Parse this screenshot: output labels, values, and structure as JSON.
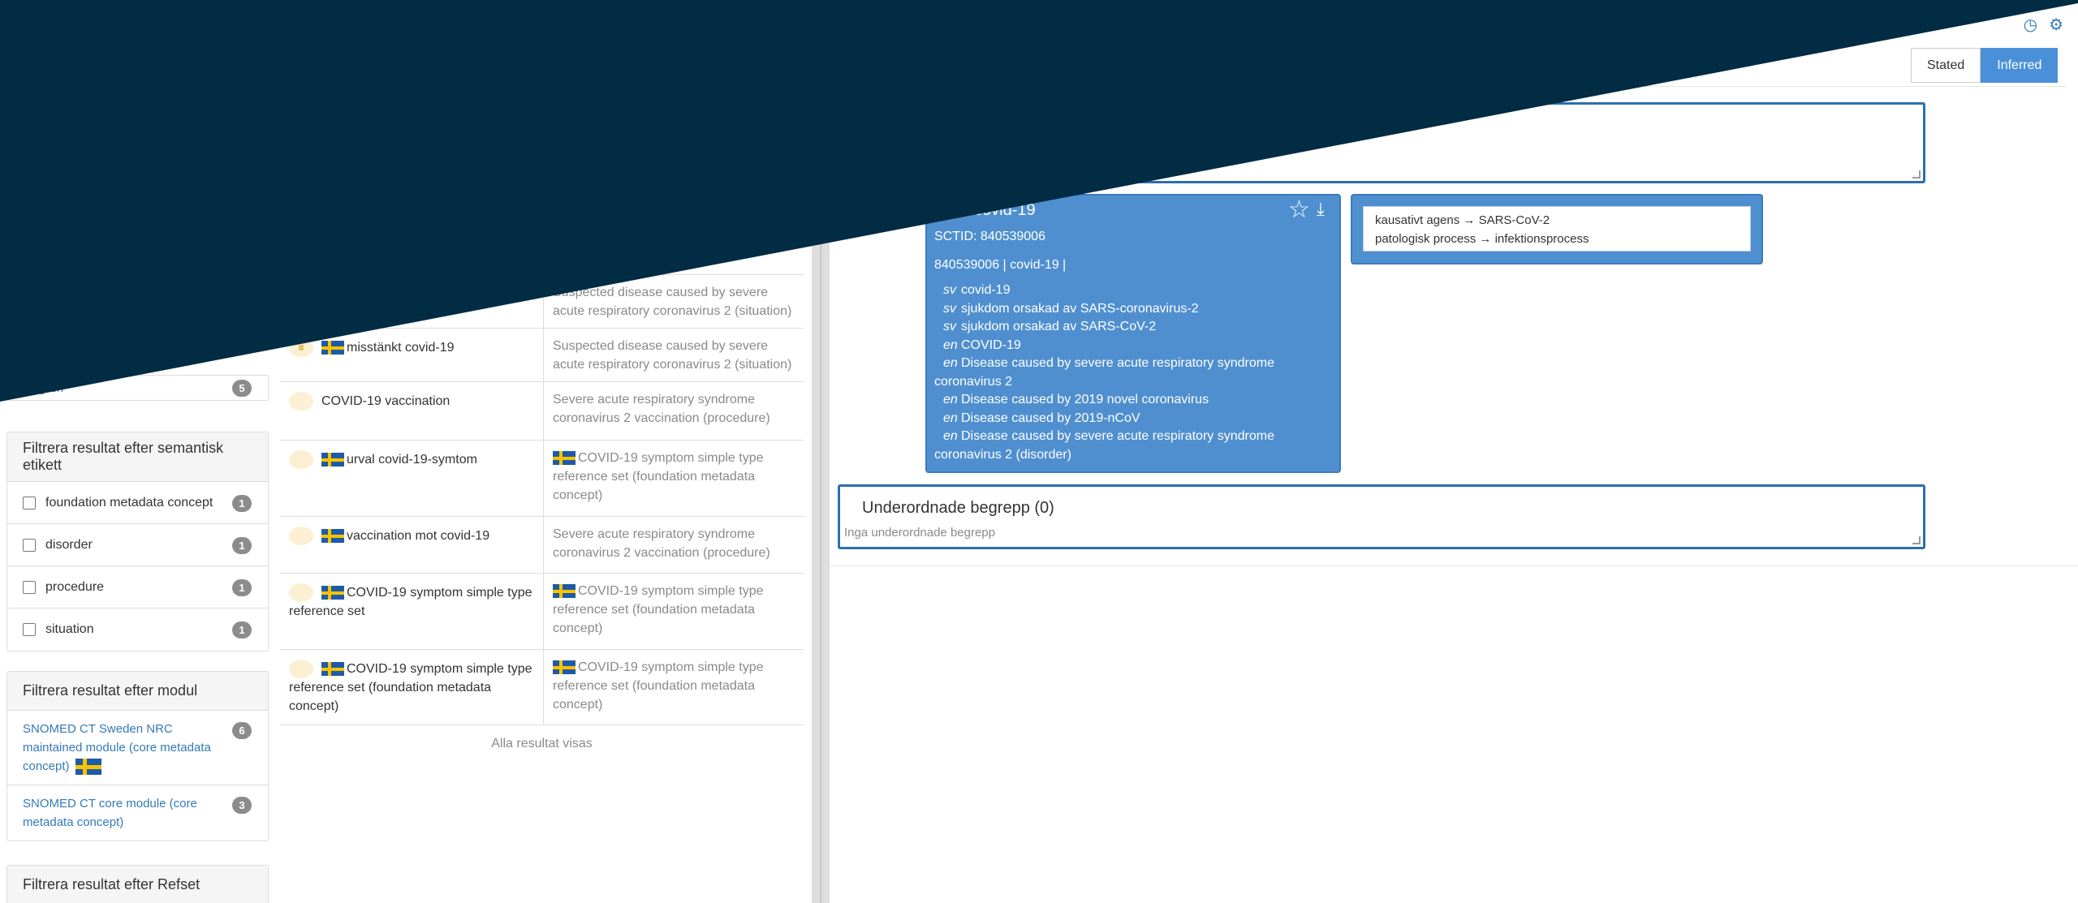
{
  "language_filter": {
    "label": "English",
    "count": "5"
  },
  "semantic_filter": {
    "title": "Filtrera resultat efter semantisk etikett",
    "items": [
      {
        "label": "foundation metadata concept",
        "count": "1"
      },
      {
        "label": "disorder",
        "count": "1"
      },
      {
        "label": "procedure",
        "count": "1"
      },
      {
        "label": "situation",
        "count": "1"
      }
    ]
  },
  "module_filter": {
    "title": "Filtrera resultat efter modul",
    "items": [
      {
        "label": "SNOMED CT Sweden NRC maintained module (core metadata concept)",
        "count": "6"
      },
      {
        "label": "SNOMED CT core module (core metadata concept)",
        "count": "3"
      }
    ]
  },
  "refset_filter": {
    "title": "Filtrera resultat efter Refset"
  },
  "results": [
    {
      "term": "",
      "fsn": "Suspected disease caused by severe acute respiratory coronavirus 2 (situation)"
    },
    {
      "term": "misstänkt covid-19",
      "fsn": "Suspected disease caused by severe acute respiratory coronavirus 2 (situation)"
    },
    {
      "term": "COVID-19 vaccination",
      "fsn": "Severe acute respiratory syndrome coronavirus 2 vaccination (procedure)"
    },
    {
      "term": "urval covid-19-symtom",
      "fsn": "COVID-19 symptom simple type reference set (foundation metadata concept)"
    },
    {
      "term": "vaccination mot covid-19",
      "fsn": "Severe acute respiratory syndrome coronavirus 2 vaccination (procedure)"
    },
    {
      "term": "COVID-19 symptom simple type reference set",
      "fsn": "COVID-19 symptom simple type reference set (foundation metadata concept)"
    },
    {
      "term": "COVID-19 symptom simple type reference set (foundation metadata concept)",
      "fsn": "COVID-19 symptom simple type reference set (foundation metadata concept)"
    }
  ],
  "all_results_shown": "Alla resultat visas",
  "view_toggle": {
    "stated": "Stated",
    "inferred": "Inferred",
    "active": "Inferred"
  },
  "concept": {
    "title": "covid-19",
    "sctid": "SCTID: 840539006",
    "fsn_line": "840539006 | covid-19 |",
    "descriptions": [
      {
        "lang": "sv",
        "text": "covid-19"
      },
      {
        "lang": "sv",
        "text": "sjukdom orsakad av SARS-coronavirus-2"
      },
      {
        "lang": "sv",
        "text": "sjukdom orsakad av SARS-CoV-2"
      },
      {
        "lang": "en",
        "text": "COVID-19"
      },
      {
        "lang": "en",
        "text": "Disease caused by severe acute respiratory syndrome coronavirus 2"
      },
      {
        "lang": "en",
        "text": "Disease caused by 2019 novel coronavirus"
      },
      {
        "lang": "en",
        "text": "Disease caused by 2019-nCoV"
      },
      {
        "lang": "en",
        "text": "Disease caused by severe acute respiratory syndrome coronavirus 2 (disorder)"
      }
    ]
  },
  "attributes": [
    {
      "type": "kausativt agens",
      "arrow": "→",
      "value": "SARS-CoV-2"
    },
    {
      "type": "patologisk process",
      "arrow": "→",
      "value": "infektionsprocess"
    }
  ],
  "children": {
    "title": "Underordnade begrepp (0)",
    "subtitle": "Inga underordnade begrepp"
  },
  "icons": {
    "history": "history-icon",
    "settings": "gear-icon",
    "star": "star-icon",
    "download": "download-icon"
  },
  "colors": {
    "overlay": "#022b44",
    "accent": "#4f8fd0",
    "link": "#337ab7"
  }
}
